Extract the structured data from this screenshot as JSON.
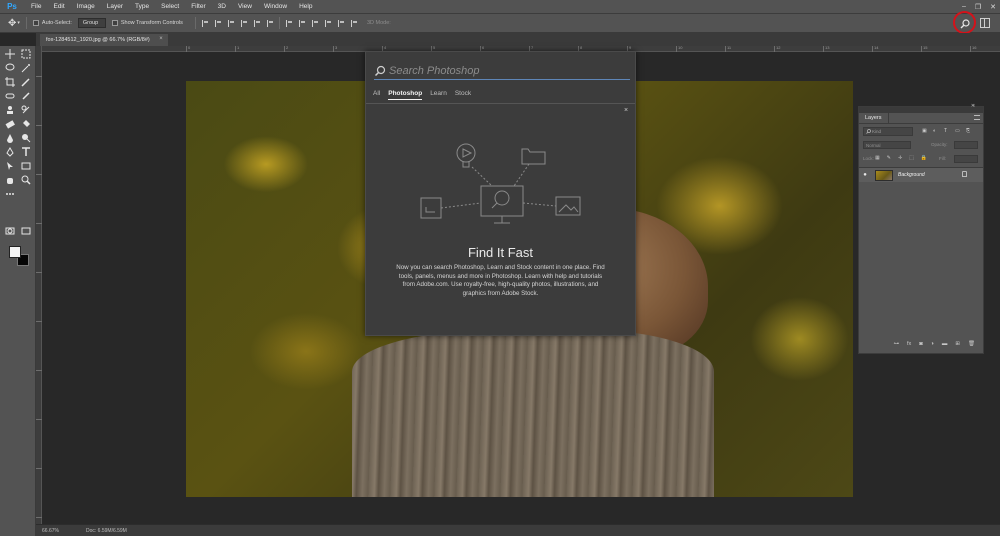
{
  "app": {
    "logo": "Ps"
  },
  "menu": [
    "File",
    "Edit",
    "Image",
    "Layer",
    "Type",
    "Select",
    "Filter",
    "3D",
    "View",
    "Window",
    "Help"
  ],
  "window_controls": {
    "minimize": "–",
    "restore": "❐",
    "close": "✕"
  },
  "options_bar": {
    "auto_select_label": "Auto-Select:",
    "auto_select_value": "Group",
    "transform_label": "Show Transform Controls",
    "mode_3d_label": "3D Mode:"
  },
  "document": {
    "tab_title": "fox-1284512_1920.jpg @ 66.7% (RGB/8#)",
    "close": "×"
  },
  "ruler_numbers": [
    "0",
    "1",
    "2",
    "3",
    "4",
    "5",
    "6",
    "7",
    "8",
    "9",
    "10",
    "11",
    "12",
    "13",
    "14",
    "15",
    "16",
    "17",
    "18",
    "19"
  ],
  "search_dialog": {
    "placeholder": "Search Photoshop",
    "tabs": [
      {
        "label": "All",
        "active": false
      },
      {
        "label": "Photoshop",
        "active": true
      },
      {
        "label": "Learn",
        "active": false
      },
      {
        "label": "Stock",
        "active": false
      }
    ],
    "close": "×",
    "heading": "Find It Fast",
    "body": "Now you can search Photoshop, Learn and Stock content in one place. Find tools, panels, menus and more in Photoshop. Learn with help and tutorials from Adobe.com. Use royalty-free, high-quality photos, illustrations, and graphics from Adobe Stock."
  },
  "layers_panel": {
    "tab": "Layers",
    "collapse": "«",
    "close": "✕",
    "filter_placeholder": "Kind",
    "blend_mode": "Normal",
    "opacity_label": "Opacity:",
    "lock_label": "Lock:",
    "fill_label": "Fill:",
    "filter_icons": [
      "▣",
      "◐",
      "T",
      "▭",
      "⎘"
    ],
    "lock_icons": [
      "▦",
      "✎",
      "✛",
      "⬚",
      "🔒"
    ],
    "layers": [
      {
        "name": "Background",
        "visible": true,
        "locked": true
      }
    ],
    "bottom_icons": [
      "⊶",
      "fx",
      "◙",
      "◑",
      "▬",
      "⊞",
      "🗑"
    ]
  },
  "status": {
    "zoom": "66.67%",
    "doc": "Doc: 6.59M/6.59M"
  },
  "colors": {
    "chrome": "#535353",
    "workspace": "#282828",
    "dialog": "#3c3c3c",
    "accent": "#31a8ff",
    "highlight_circle": "#d4121a"
  },
  "icons": {
    "search": "search-icon",
    "workspace": "workspace-icon",
    "move": "move-icon"
  }
}
